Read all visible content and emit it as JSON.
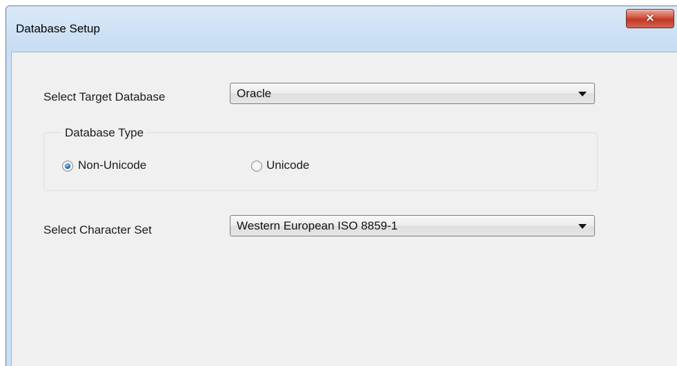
{
  "window": {
    "title": "Database Setup",
    "close_icon": "×"
  },
  "form": {
    "target_database": {
      "label": "Select Target Database",
      "value": "Oracle"
    },
    "database_type": {
      "legend": "Database Type",
      "options": [
        {
          "label": "Non-Unicode",
          "selected": true
        },
        {
          "label": "Unicode",
          "selected": false
        }
      ]
    },
    "character_set": {
      "label": "Select Character Set",
      "value": "Western European ISO 8859-1"
    }
  }
}
